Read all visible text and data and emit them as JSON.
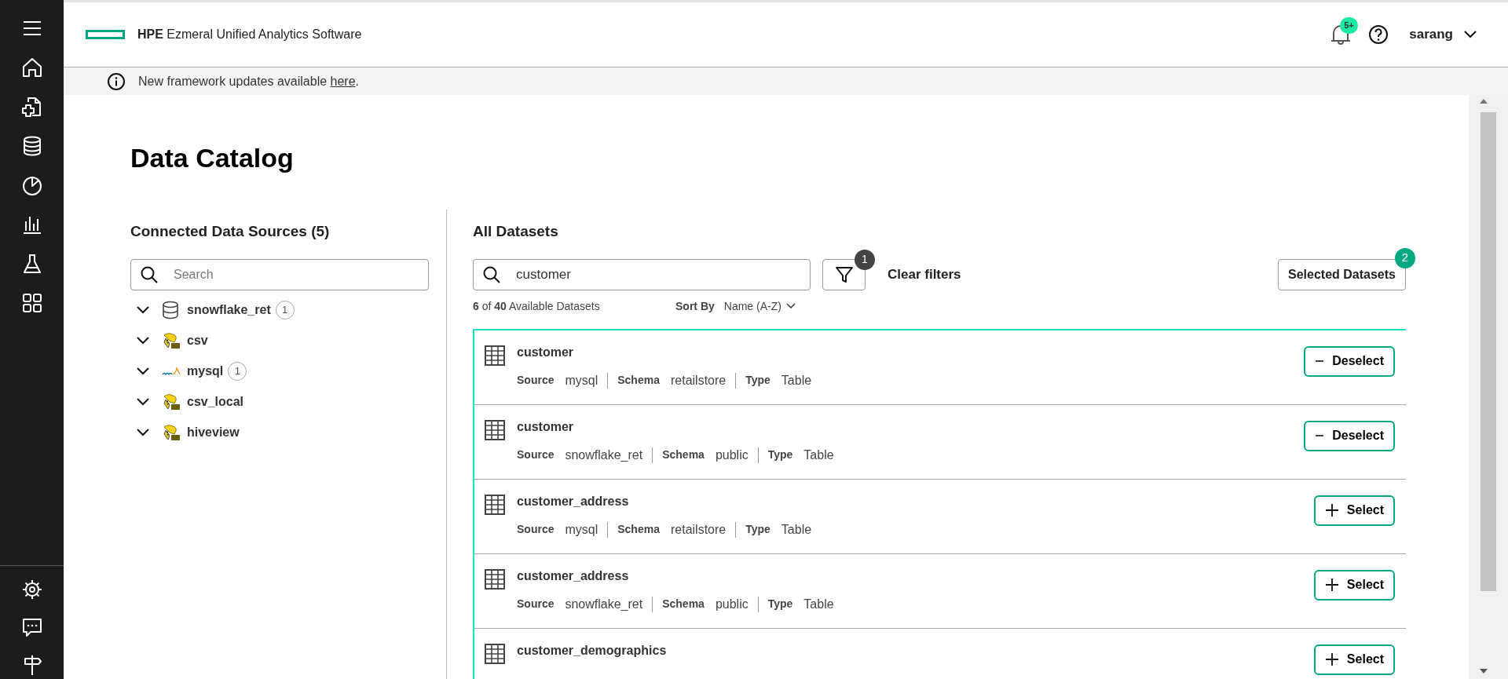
{
  "header": {
    "brand_bold": "HPE",
    "brand_rest": "Ezmeral Unified Analytics Software",
    "notifications_badge": "5+",
    "user": "sarang"
  },
  "notice": {
    "text": "New framework updates available ",
    "link": "here",
    "end": "."
  },
  "page_title": "Data Catalog",
  "sources_panel": {
    "title": "Connected Data Sources (5)",
    "search": {
      "placeholder": "Search"
    },
    "sources": [
      {
        "name": "snowflake_ret",
        "kind": "database",
        "count": "1"
      },
      {
        "name": "csv",
        "kind": "hive"
      },
      {
        "name": "mysql",
        "kind": "mysql",
        "count": "1"
      },
      {
        "name": "csv_local",
        "kind": "hive"
      },
      {
        "name": "hiveview",
        "kind": "hive"
      }
    ]
  },
  "datasets_panel": {
    "title": "All Datasets",
    "search": {
      "value": "customer"
    },
    "filter_count": "1",
    "clear_filters": "Clear filters",
    "selected_button": "Selected Datasets",
    "selected_count": "2",
    "summary_shown": "6",
    "summary_of": "of",
    "summary_total": "40",
    "summary_rest": "Available Datasets",
    "sort_label": "Sort By",
    "sort_value": "Name (A-Z)",
    "datasets": [
      {
        "name": "customer",
        "fields": [
          {
            "label": "Source",
            "value": "mysql"
          },
          {
            "label": "Schema",
            "value": "retailstore"
          },
          {
            "label": "Type",
            "value": "Table"
          }
        ],
        "selected": true,
        "action": "Deselect"
      },
      {
        "name": "customer",
        "fields": [
          {
            "label": "Source",
            "value": "snowflake_ret"
          },
          {
            "label": "Schema",
            "value": "public"
          },
          {
            "label": "Type",
            "value": "Table"
          }
        ],
        "selected": true,
        "action": "Deselect"
      },
      {
        "name": "customer_address",
        "fields": [
          {
            "label": "Source",
            "value": "mysql"
          },
          {
            "label": "Schema",
            "value": "retailstore"
          },
          {
            "label": "Type",
            "value": "Table"
          }
        ],
        "selected": false,
        "action": "Select"
      },
      {
        "name": "customer_address",
        "fields": [
          {
            "label": "Source",
            "value": "snowflake_ret"
          },
          {
            "label": "Schema",
            "value": "public"
          },
          {
            "label": "Type",
            "value": "Table"
          }
        ],
        "selected": false,
        "action": "Select"
      },
      {
        "name": "customer_demographics",
        "selected": false,
        "action": "Select"
      }
    ]
  }
}
